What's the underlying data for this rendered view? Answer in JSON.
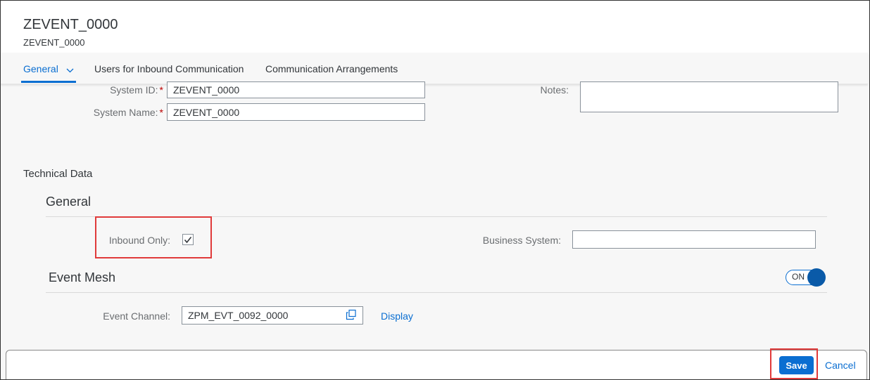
{
  "header": {
    "title": "ZEVENT_0000",
    "subtitle": "ZEVENT_0000"
  },
  "tabs": [
    {
      "label": "General",
      "active": true
    },
    {
      "label": "Users for Inbound Communication",
      "active": false
    },
    {
      "label": "Communication Arrangements",
      "active": false
    }
  ],
  "form": {
    "system_id": {
      "label": "System ID:",
      "value": "ZEVENT_0000",
      "required": "*"
    },
    "system_name": {
      "label": "System Name:",
      "value": "ZEVENT_0000",
      "required": "*"
    },
    "notes": {
      "label": "Notes:",
      "value": ""
    }
  },
  "technical": {
    "heading": "Technical Data",
    "general": {
      "title": "General",
      "inbound_only": {
        "label": "Inbound Only:",
        "checked": true
      },
      "business_system": {
        "label": "Business System:",
        "value": ""
      }
    },
    "event_mesh": {
      "title": "Event Mesh",
      "toggle": {
        "label": "ON",
        "on": true
      },
      "event_channel": {
        "label": "Event Channel:",
        "value": "ZPM_EVT_0092_0000",
        "link": "Display"
      }
    }
  },
  "footer": {
    "save_label": "Save",
    "cancel_label": "Cancel"
  },
  "colors": {
    "accent": "#0a6ed1",
    "required": "#bb0000",
    "highlight": "#e03a3a"
  }
}
